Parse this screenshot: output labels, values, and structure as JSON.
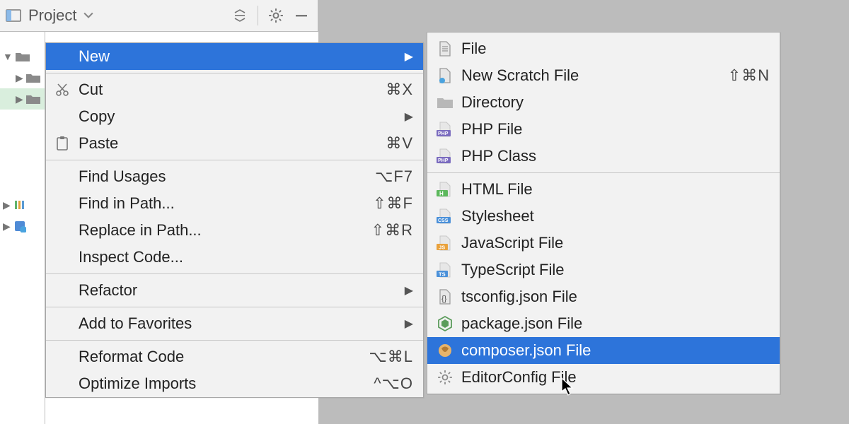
{
  "toolbar": {
    "project_label": "Project"
  },
  "context_menu": {
    "new": "New",
    "cut": "Cut",
    "cut_shortcut": "⌘X",
    "copy": "Copy",
    "paste": "Paste",
    "paste_shortcut": "⌘V",
    "find_usages": "Find Usages",
    "find_usages_shortcut": "⌥F7",
    "find_in_path": "Find in Path...",
    "find_in_path_shortcut": "⇧⌘F",
    "replace_in_path": "Replace in Path...",
    "replace_in_path_shortcut": "⇧⌘R",
    "inspect_code": "Inspect Code...",
    "refactor": "Refactor",
    "add_to_favorites": "Add to Favorites",
    "reformat_code": "Reformat Code",
    "reformat_code_shortcut": "⌥⌘L",
    "optimize_imports": "Optimize Imports",
    "optimize_imports_shortcut": "^⌥O"
  },
  "new_menu": {
    "file": "File",
    "new_scratch_file": "New Scratch File",
    "new_scratch_file_shortcut": "⇧⌘N",
    "directory": "Directory",
    "php_file": "PHP File",
    "php_class": "PHP Class",
    "html_file": "HTML File",
    "stylesheet": "Stylesheet",
    "javascript_file": "JavaScript File",
    "typescript_file": "TypeScript File",
    "tsconfig_file": "tsconfig.json File",
    "package_json_file": "package.json File",
    "composer_json_file": "composer.json File",
    "editorconfig_file": "EditorConfig File"
  }
}
